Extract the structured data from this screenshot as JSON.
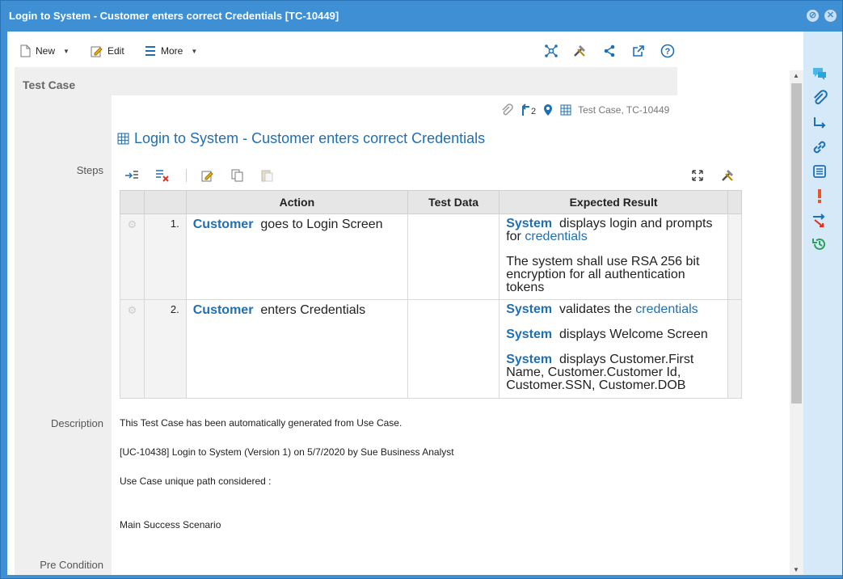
{
  "window": {
    "title": "Login to System - Customer enters correct Credentials [TC-10449]"
  },
  "toolbar": {
    "new_label": "New",
    "edit_label": "Edit",
    "more_label": "More"
  },
  "section": {
    "title": "Test Case"
  },
  "meta": {
    "relations_count": "2",
    "type_id": "Test Case, TC-10449"
  },
  "item": {
    "title": "Login to System - Customer enters correct Credentials"
  },
  "labels": {
    "steps": "Steps",
    "description": "Description",
    "pre_condition": "Pre Condition"
  },
  "steps_table": {
    "headers": {
      "action": "Action",
      "test_data": "Test Data",
      "expected": "Expected Result"
    },
    "rows": [
      {
        "num": "1.",
        "actor": "Customer",
        "action": "goes to Login Screen",
        "test_data": "",
        "expected": [
          {
            "actor": "System",
            "text": "displays login and prompts for",
            "link": "credentials"
          },
          {
            "actor": "",
            "text": "The system shall use RSA 256 bit encryption for all authentication tokens",
            "link": ""
          }
        ]
      },
      {
        "num": "2.",
        "actor": "Customer",
        "action": "enters Credentials",
        "test_data": "",
        "expected": [
          {
            "actor": "System",
            "text": "validates the",
            "link": "credentials"
          },
          {
            "actor": "System",
            "text": "displays Welcome Screen",
            "link": ""
          },
          {
            "actor": "System",
            "text": "displays Customer.First Name, Customer.Customer Id, Customer.SSN, Customer.DOB",
            "link": ""
          }
        ]
      }
    ]
  },
  "description": {
    "line1": "This Test Case has been automatically generated from Use Case.",
    "line2": "[UC-10438] Login to System (Version 1) on 5/7/2020 by Sue Business Analyst",
    "line3": "Use Case unique path considered :",
    "line4": "Main Success Scenario"
  },
  "colors": {
    "titlebar": "#3f8fd4",
    "accent": "#1f6fb5",
    "rail": "#d6e9f8"
  }
}
